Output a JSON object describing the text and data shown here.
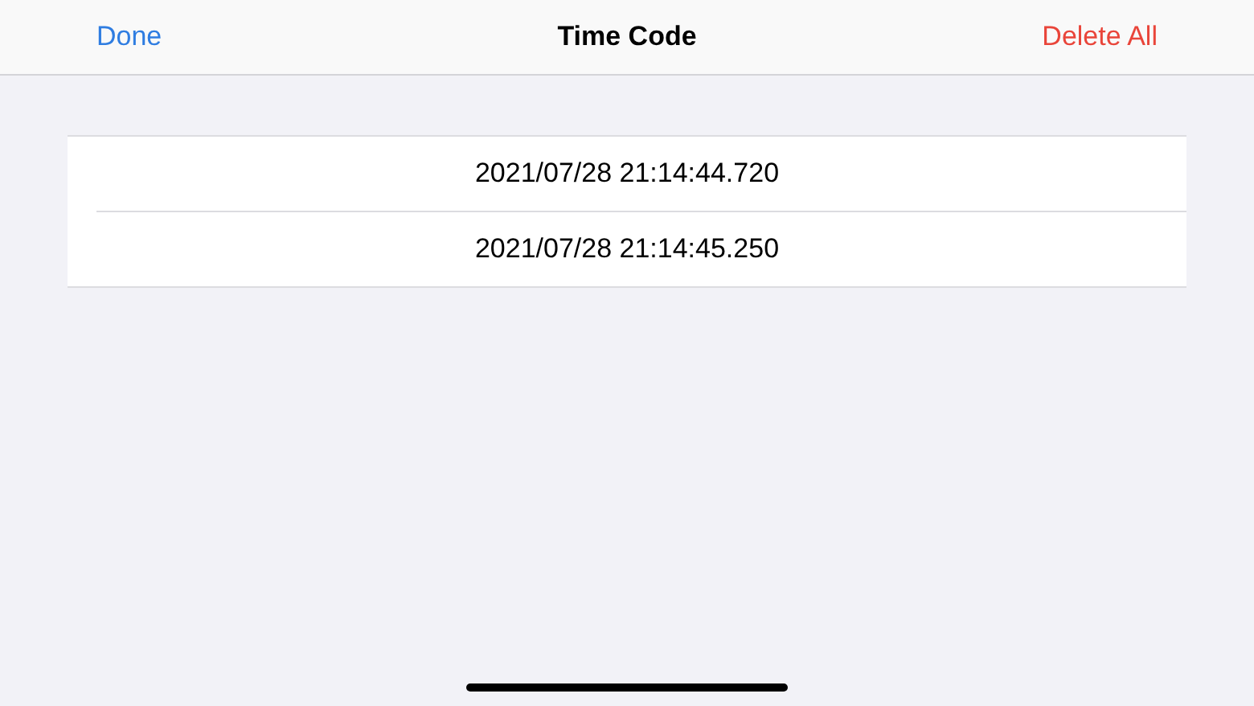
{
  "navbar": {
    "left_button": "Done",
    "title": "Time Code",
    "right_button": "Delete All"
  },
  "entries": [
    "2021/07/28 21:14:44.720",
    "2021/07/28 21:14:45.250"
  ]
}
